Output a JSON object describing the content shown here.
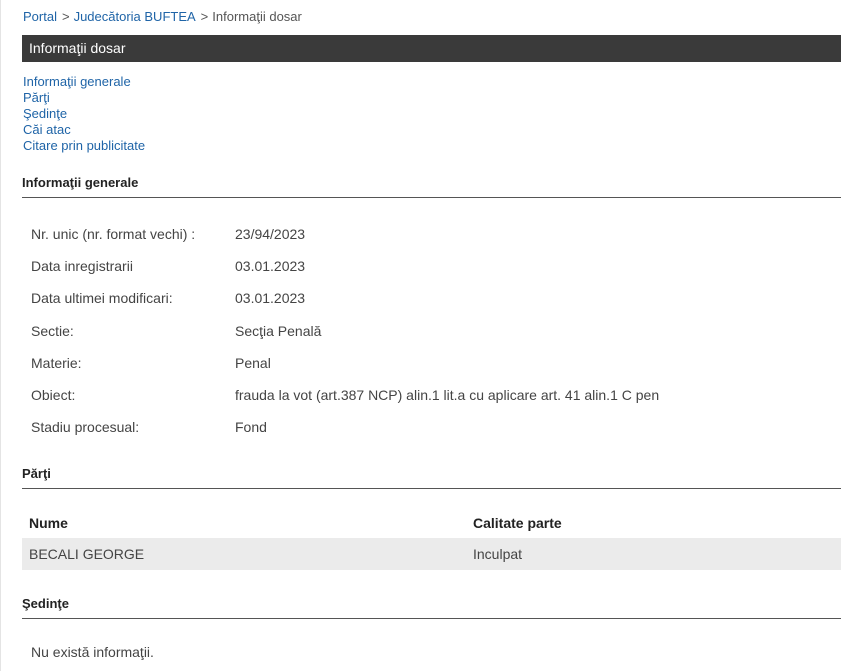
{
  "breadcrumb": {
    "portal": "Portal",
    "court": "Judecătoria BUFTEA",
    "current": "Informaţii dosar",
    "separator": ">"
  },
  "titlebar": {
    "title": "Informaţii dosar"
  },
  "nav": {
    "items": [
      {
        "label": "Informaţii generale"
      },
      {
        "label": "Părţi"
      },
      {
        "label": "Şedinţe"
      },
      {
        "label": "Căi atac"
      },
      {
        "label": "Citare prin publicitate"
      }
    ]
  },
  "general": {
    "title": "Informaţii generale",
    "rows": [
      {
        "label": "Nr. unic (nr. format vechi) :",
        "value": "23/94/2023"
      },
      {
        "label": "Data inregistrarii",
        "value": "03.01.2023"
      },
      {
        "label": "Data ultimei modificari:",
        "value": "03.01.2023"
      },
      {
        "label": "Sectie:",
        "value": "Secţia Penală"
      },
      {
        "label": "Materie:",
        "value": "Penal"
      },
      {
        "label": "Obiect:",
        "value": "frauda la vot (art.387 NCP) alin.1 lit.a cu aplicare art. 41 alin.1 C pen"
      },
      {
        "label": "Stadiu procesual:",
        "value": "Fond"
      }
    ]
  },
  "parti": {
    "title": "Părţi",
    "headers": [
      "Nume",
      "Calitate parte"
    ],
    "rows": [
      {
        "name": "BECALI GEORGE",
        "role": "Inculpat"
      }
    ]
  },
  "sedinte": {
    "title": "Şedinţe",
    "empty": "Nu există informaţii."
  }
}
